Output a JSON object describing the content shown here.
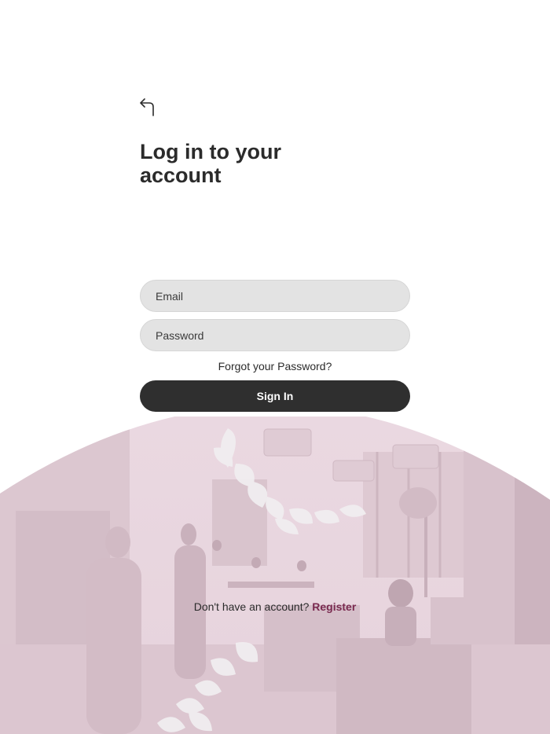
{
  "header": {
    "title": "Log in to your account"
  },
  "form": {
    "email_placeholder": "Email",
    "password_placeholder": "Password",
    "forgot_label": "Forgot your Password?",
    "signin_label": "Sign In"
  },
  "footer": {
    "prompt": "Don't have an account?",
    "register_label": "Register"
  },
  "icons": {
    "back": "back-arrow-icon"
  },
  "colors": {
    "accent": "#7a2a50",
    "button": "#2f2f2f",
    "field": "#e3e3e3",
    "tint": "#ead7e0"
  }
}
